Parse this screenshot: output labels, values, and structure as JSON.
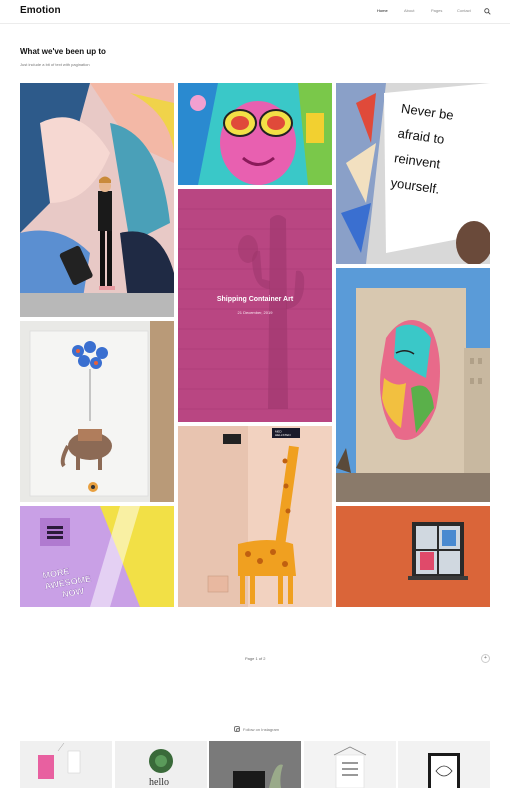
{
  "header": {
    "logo": "Emotion",
    "nav": [
      "Home",
      "About",
      "Pages",
      "Contact"
    ]
  },
  "section": {
    "title": "What we've been up to",
    "subtitle": "Just include a bit of text with pagination"
  },
  "gallery": {
    "featured_title": "Shipping Container Art",
    "featured_date": "21 December, 2019",
    "mural_text": "Never be afraid to reinvent yourself.",
    "sticker_text": "MORE AWESOME NOW",
    "sign_text": "MED HELLSTEN"
  },
  "pagination": {
    "label": "Page 1 of 2",
    "next_icon": "plus-icon"
  },
  "instagram": {
    "label": "Follow on Instagram",
    "icon": "instagram-icon"
  },
  "colors": {
    "accent_pink": "#c94d8e",
    "orange_wall": "#e0683c",
    "sky": "#5a9bd8"
  }
}
